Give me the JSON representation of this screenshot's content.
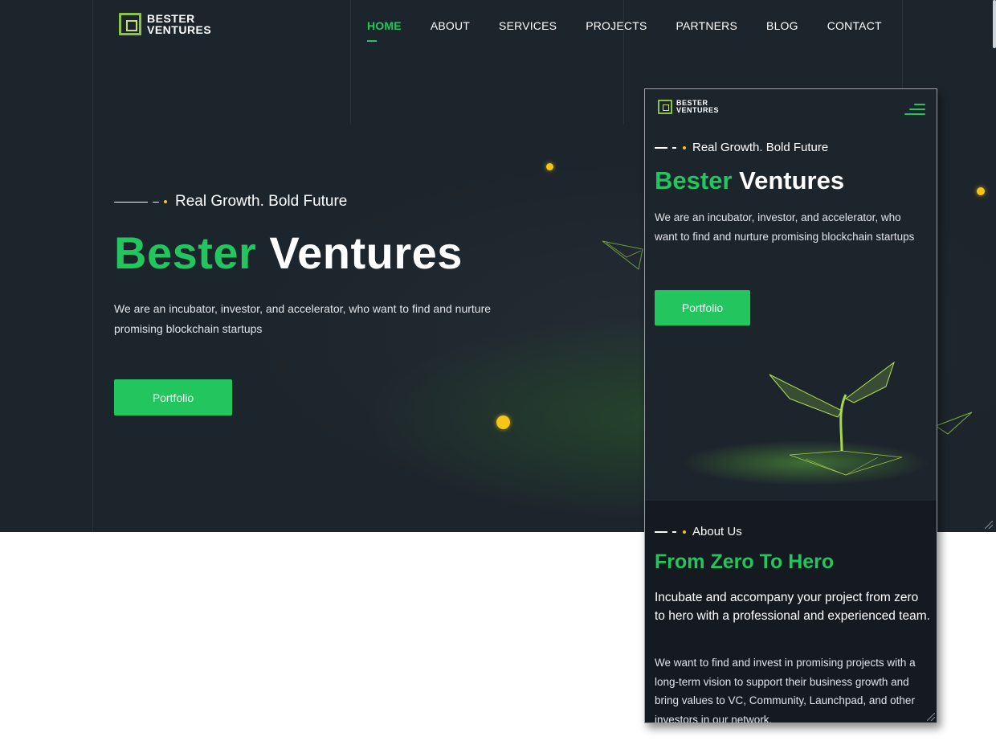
{
  "brand": {
    "line1": "BESTER",
    "line2": "VENTURES"
  },
  "nav": {
    "items": [
      "HOME",
      "ABOUT",
      "SERVICES",
      "PROJECTS",
      "PARTNERS",
      "BLOG",
      "CONTACT"
    ],
    "active": "HOME"
  },
  "hero": {
    "tagline": "Real Growth. Bold Future",
    "title_accent": "Bester",
    "title_rest": "Ventures",
    "description": "We are an incubator, investor, and accelerator, who want to find and nurture promising blockchain startups",
    "cta_label": "Portfolio"
  },
  "mobile": {
    "menu_icon": "hamburger-menu-icon",
    "about": {
      "tagline": "About Us",
      "title": "From Zero To Hero",
      "lead": "Incubate and accompany your project from zero to hero with a professional and experienced team.",
      "body": "We want to find and invest in promising projects with a long-term vision to support their business growth and bring values to VC, Community, Launchpad, and other investors in our network."
    }
  },
  "colors": {
    "accent": "#22c55e",
    "background": "#1d252c",
    "highlight": "#f5c518"
  }
}
